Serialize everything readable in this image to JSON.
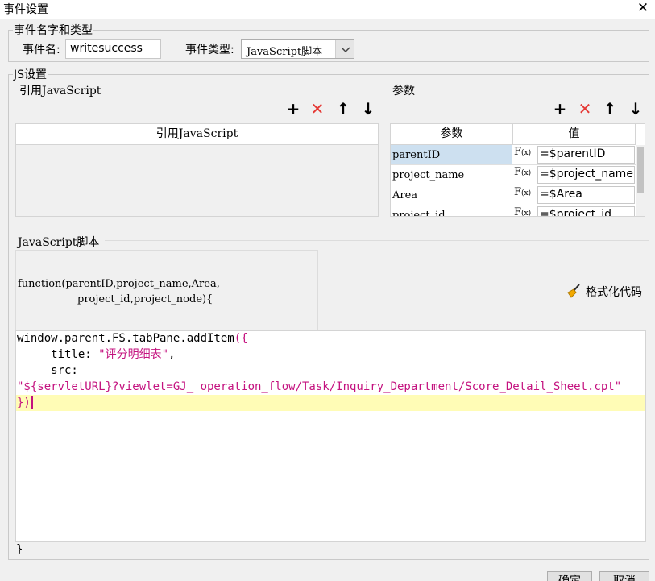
{
  "window": {
    "title": "事件设置"
  },
  "event_group": {
    "legend": "事件名字和类型",
    "name_label": "事件名:",
    "name_value": "writesuccess",
    "type_label": "事件类型:",
    "type_value": "JavaScript脚本"
  },
  "js_group": {
    "legend": "JS设置",
    "ref_section_label": "引用JavaScript",
    "ref_table_header": "引用JavaScript",
    "params_section_label": "参数",
    "params_headers": [
      "参数",
      "值"
    ],
    "params": [
      {
        "name": "parentID",
        "value": "=$parentID"
      },
      {
        "name": "project_name",
        "value": "=$project_name"
      },
      {
        "name": "Area",
        "value": "=$Area"
      },
      {
        "name": "project_id",
        "value": "=$project_id"
      }
    ],
    "fx_label": "F",
    "fx_sub": "(x)",
    "script_section_label": "JavaScript脚本",
    "function_sig_line1": "function(parentID,project_name,Area,",
    "function_sig_line2": "project_id,project_node){",
    "format_label": "格式化代码",
    "code": {
      "l1_plain": "window.parent.FS.tabPane.addItem",
      "l1_brace": "({",
      "l2_plain": "     title: ",
      "l2_str": "\"评分明细表\"",
      "l2_tail": ",",
      "l3_plain": "     src:",
      "l4_str": "\"${servletURL}?viewlet=GJ_ operation_flow/Task/Inquiry_Department/Score_Detail_Sheet.cpt\"",
      "l5_brace": "})"
    },
    "closing_brace": "}"
  },
  "footer": {
    "ok_label": "确定",
    "cancel_label": "取消"
  },
  "colors": {
    "accent_red": "#e53935",
    "code_string": "#c4127f",
    "line_highlight": "#fffcb6",
    "selected_row": "#cde0f0"
  }
}
